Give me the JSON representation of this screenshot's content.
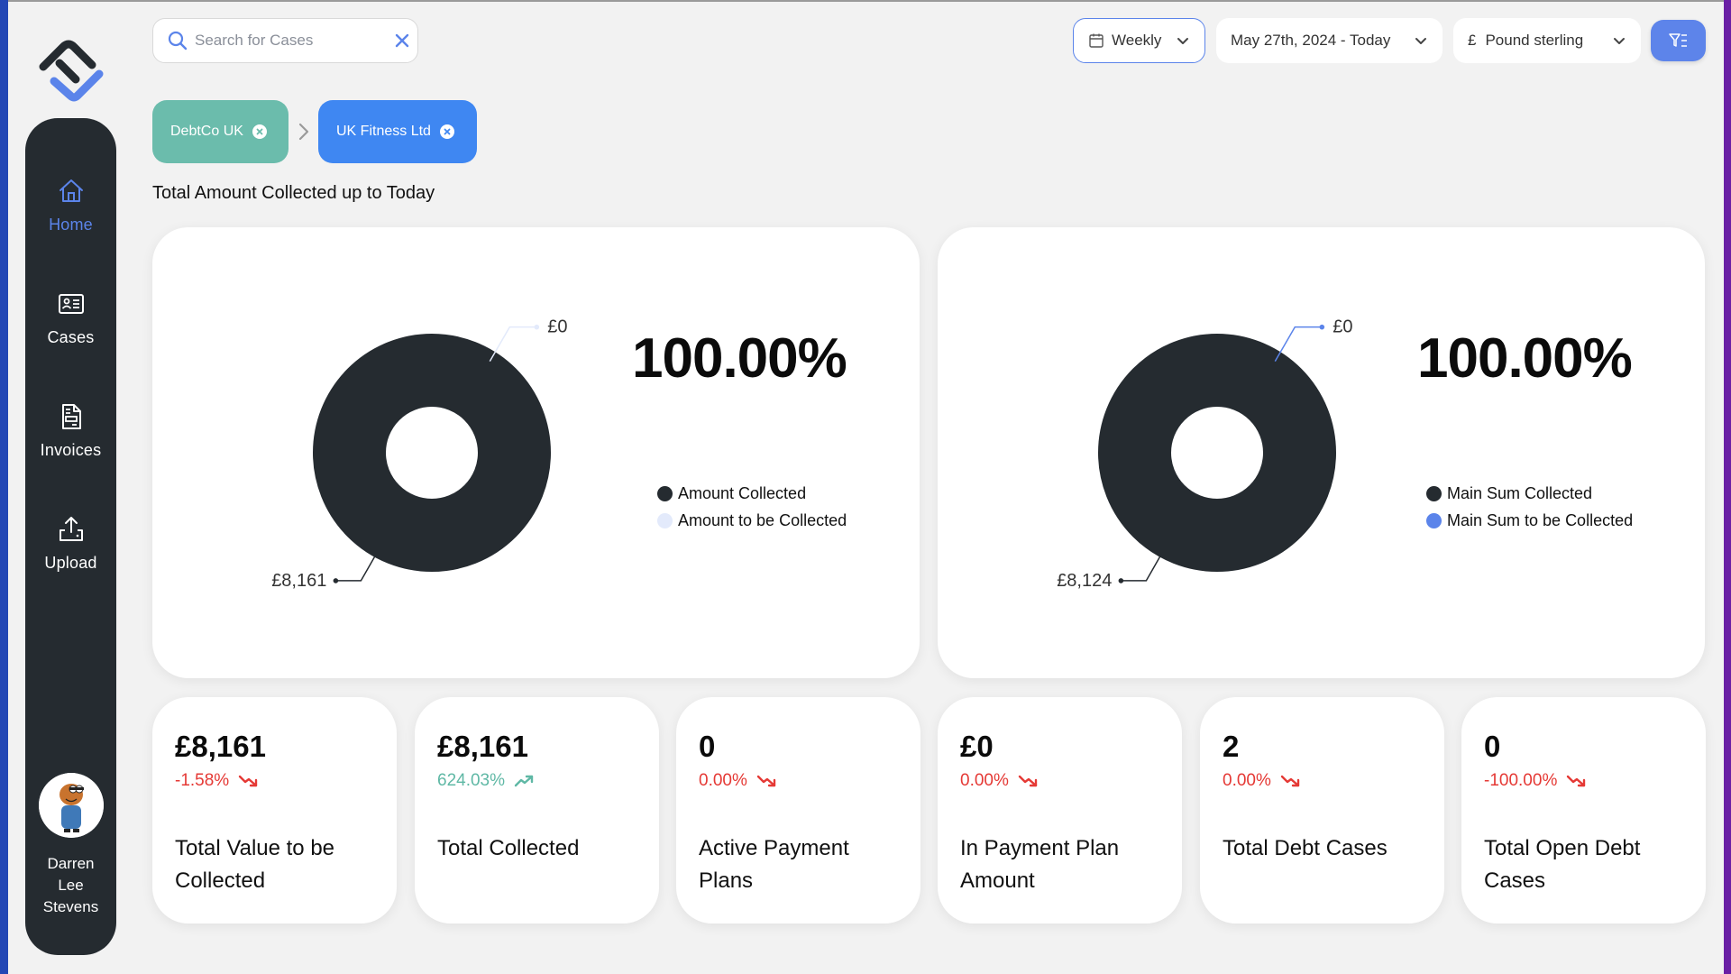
{
  "app": {
    "brand_colors": {
      "dark": "#252b30",
      "accent": "#5b84ea"
    }
  },
  "sidebar": {
    "items": [
      {
        "label": "Home",
        "icon": "home-icon",
        "active": true
      },
      {
        "label": "Cases",
        "icon": "id-card-icon",
        "active": false
      },
      {
        "label": "Invoices",
        "icon": "document-icon",
        "active": false
      },
      {
        "label": "Upload",
        "icon": "upload-icon",
        "active": false
      }
    ],
    "user": {
      "name_line1": "Darren",
      "name_line2": "Lee",
      "name_line3": "Stevens"
    }
  },
  "header": {
    "search": {
      "placeholder": "Search for Cases",
      "value": ""
    },
    "period": {
      "label": "Weekly",
      "icon": "calendar-icon"
    },
    "date_range": {
      "label": "May 27th, 2024 - Today"
    },
    "currency": {
      "symbol": "£",
      "label": "Pound sterling"
    },
    "filter_button": {
      "icon": "filter-list-icon"
    }
  },
  "breadcrumb": {
    "items": [
      {
        "label": "DebtCo UK",
        "color": "#6bbcac"
      },
      {
        "label": "UK Fitness Ltd",
        "color": "#3f87f2"
      }
    ]
  },
  "section": {
    "title": "Total Amount Collected up to Today"
  },
  "chart_data": [
    {
      "type": "pie",
      "title": "Amount Collected",
      "percentage_label": "100.00%",
      "categories": [
        "Amount Collected",
        "Amount to be Collected"
      ],
      "values": [
        8161,
        0
      ],
      "value_labels": [
        "£8,161",
        "£0"
      ],
      "colors": [
        "#252b30",
        "#e3eafb"
      ],
      "legend": "right"
    },
    {
      "type": "pie",
      "title": "Main Sum Collected",
      "percentage_label": "100.00%",
      "categories": [
        "Main Sum Collected",
        "Main Sum to be Collected"
      ],
      "values": [
        8124,
        0
      ],
      "value_labels": [
        "£8,124",
        "£0"
      ],
      "colors": [
        "#252b30",
        "#5b84ea"
      ],
      "legend": "right"
    }
  ],
  "stats": [
    {
      "value": "£8,161",
      "change": "-1.58%",
      "trend": "down",
      "label": "Total Value to be Collected"
    },
    {
      "value": "£8,161",
      "change": "624.03%",
      "trend": "up",
      "label": "Total Collected"
    },
    {
      "value": "0",
      "change": "0.00%",
      "trend": "down",
      "label": "Active Payment Plans"
    },
    {
      "value": "£0",
      "change": "0.00%",
      "trend": "down",
      "label": "In Payment Plan Amount"
    },
    {
      "value": "2",
      "change": "0.00%",
      "trend": "down",
      "label": "Total Debt Cases"
    },
    {
      "value": "0",
      "change": "-100.00%",
      "trend": "down",
      "label": "Total Open Debt Cases"
    }
  ],
  "trend_colors": {
    "up": "#5fb8a5",
    "down": "#e53935"
  }
}
